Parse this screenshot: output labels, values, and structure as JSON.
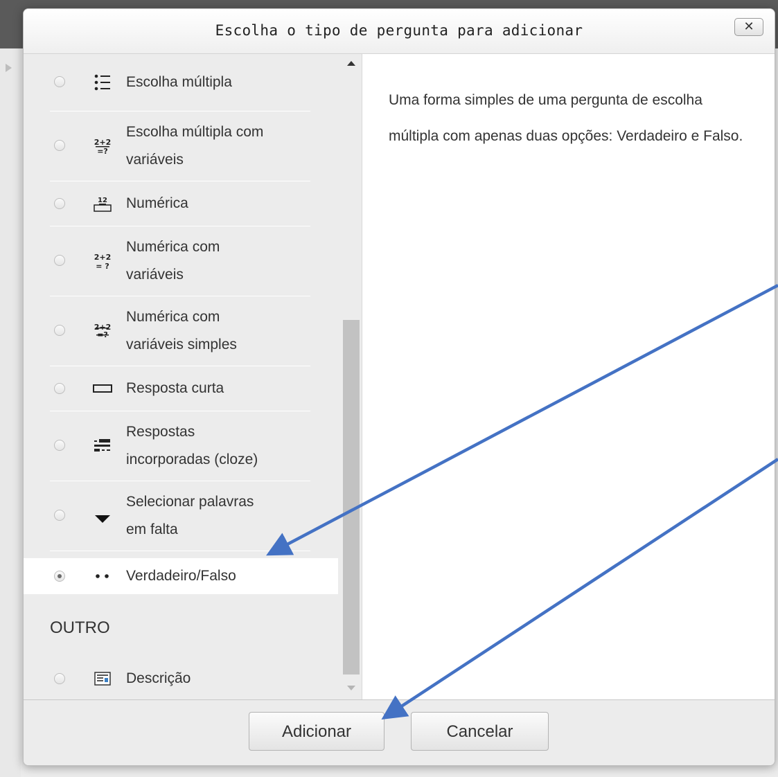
{
  "dialog": {
    "title": "Escolha o tipo de pergunta para adicionar",
    "close_label": "✕"
  },
  "question_types": [
    {
      "line1": "Escolha múltipla",
      "line2": "",
      "icon": "multichoice-icon",
      "selected": false
    },
    {
      "line1": "Escolha múltipla com",
      "line2": "variáveis",
      "icon": "calculated-multichoice-icon",
      "selected": false
    },
    {
      "line1": "Numérica",
      "line2": "",
      "icon": "numerical-icon",
      "selected": false
    },
    {
      "line1": "Numérica com",
      "line2": "variáveis",
      "icon": "calculated-icon",
      "selected": false
    },
    {
      "line1": "Numérica com",
      "line2": "variáveis simples",
      "icon": "calculated-simple-icon",
      "selected": false
    },
    {
      "line1": "Resposta curta",
      "line2": "",
      "icon": "short-answer-icon",
      "selected": false
    },
    {
      "line1": "Respostas",
      "line2": "incorporadas (cloze)",
      "icon": "cloze-icon",
      "selected": false
    },
    {
      "line1": "Selecionar palavras",
      "line2": "em falta",
      "icon": "dropdown-icon",
      "selected": false
    },
    {
      "line1": "Verdadeiro/Falso",
      "line2": "",
      "icon": "truefalse-icon",
      "selected": true
    }
  ],
  "other_section": {
    "heading": "OUTRO",
    "items": [
      {
        "line1": "Descrição",
        "line2": "",
        "icon": "description-icon",
        "selected": false
      }
    ]
  },
  "description": {
    "text": "Uma forma simples de uma pergunta de escolha múltipla com apenas duas opções: Verdadeiro e Falso."
  },
  "footer": {
    "add_label": "Adicionar",
    "cancel_label": "Cancelar"
  },
  "colors": {
    "annotation_arrow": "#4472c4",
    "pane_background": "#ececec",
    "selected_row": "#ffffff"
  }
}
